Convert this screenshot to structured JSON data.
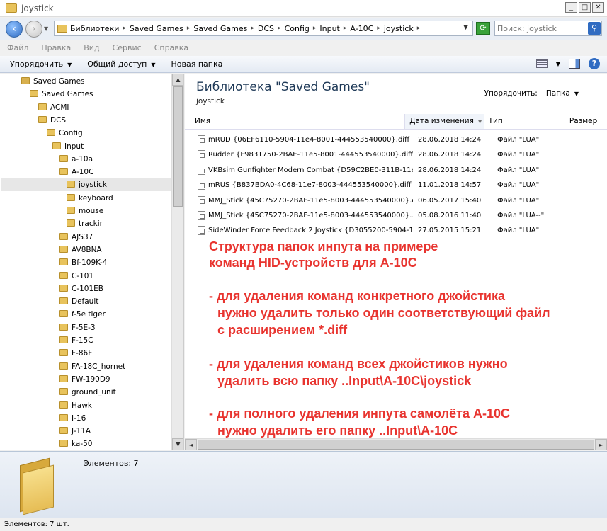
{
  "window": {
    "title": "joystick"
  },
  "address": {
    "crumbs": [
      "Библиотеки",
      "Saved Games",
      "Saved Games",
      "DCS",
      "Config",
      "Input",
      "A-10C",
      "joystick"
    ]
  },
  "search": {
    "placeholder": "Поиск: joystick"
  },
  "menu": [
    "Файл",
    "Правка",
    "Вид",
    "Сервис",
    "Справка"
  ],
  "toolbar": {
    "organize": "Упорядочить",
    "share": "Общий доступ",
    "new_folder": "Новая папка"
  },
  "tree": [
    {
      "label": "Saved Games",
      "depth": 0
    },
    {
      "label": "Saved Games",
      "depth": 1
    },
    {
      "label": "ACMI",
      "depth": 2
    },
    {
      "label": "DCS",
      "depth": 2
    },
    {
      "label": "Config",
      "depth": 3
    },
    {
      "label": "Input",
      "depth": 4
    },
    {
      "label": "a-10a",
      "depth": 5
    },
    {
      "label": "A-10C",
      "depth": 5
    },
    {
      "label": "joystick",
      "depth": 6
    },
    {
      "label": "keyboard",
      "depth": 6
    },
    {
      "label": "mouse",
      "depth": 6
    },
    {
      "label": "trackir",
      "depth": 6
    },
    {
      "label": "AJS37",
      "depth": 5
    },
    {
      "label": "AV8BNA",
      "depth": 5
    },
    {
      "label": "Bf-109K-4",
      "depth": 5
    },
    {
      "label": "C-101",
      "depth": 5
    },
    {
      "label": "C-101EB",
      "depth": 5
    },
    {
      "label": "Default",
      "depth": 5
    },
    {
      "label": "f-5e tiger",
      "depth": 5
    },
    {
      "label": "F-5E-3",
      "depth": 5
    },
    {
      "label": "F-15C",
      "depth": 5
    },
    {
      "label": "F-86F",
      "depth": 5
    },
    {
      "label": "FA-18C_hornet",
      "depth": 5
    },
    {
      "label": "FW-190D9",
      "depth": 5
    },
    {
      "label": "ground_unit",
      "depth": 5
    },
    {
      "label": "Hawk",
      "depth": 5
    },
    {
      "label": "I-16",
      "depth": 5
    },
    {
      "label": "J-11A",
      "depth": 5
    },
    {
      "label": "ka-50",
      "depth": 5
    }
  ],
  "library": {
    "title": "Библиотека \"Saved Games\"",
    "subtitle": "joystick",
    "arrange_label": "Упорядочить:",
    "arrange_value": "Папка"
  },
  "columns": {
    "name": "Имя",
    "date": "Дата изменения",
    "type": "Тип",
    "size": "Размер"
  },
  "files": [
    {
      "name": "mRUD {06EF6110-5904-11e4-8001-444553540000}.diff",
      "date": "28.06.2018 14:24",
      "type": "Файл \"LUA\""
    },
    {
      "name": "Rudder {F9831750-2BAE-11e5-8001-444553540000}.diff",
      "date": "28.06.2018 14:24",
      "type": "Файл \"LUA\""
    },
    {
      "name": "VKBsim Gunfighter Modern Combat  {D59C2BE0-311B-11e...",
      "date": "28.06.2018 14:24",
      "type": "Файл \"LUA\""
    },
    {
      "name": "mRUS {B837BDA0-4C68-11e7-8003-444553540000}.diff",
      "date": "11.01.2018 14:57",
      "type": "Файл \"LUA\""
    },
    {
      "name": "MMJ_Stick {45C75270-2BAF-11e5-8003-444553540000}.diff",
      "date": "06.05.2017 15:40",
      "type": "Файл \"LUA\""
    },
    {
      "name": "MMJ_Stick {45C75270-2BAF-11e5-8003-444553540000}....",
      "date": "05.08.2016 11:40",
      "type": "Файл \"LUA--\""
    },
    {
      "name": "SideWinder Force Feedback 2 Joystick {D3055200-5904-1...",
      "date": "27.05.2015 15:21",
      "type": "Файл \"LUA\""
    }
  ],
  "notes": [
    "Структура папок инпута на примере",
    "команд HID-устройств для А-10С",
    "- для удаления команд конкретного джойстика",
    "  нужно удалить только один соответствующий файл",
    "  с расширением *.diff",
    "- для удаления команд всех джойстиков нужно",
    "  удалить всю папку ..Input\\A-10C\\joystick",
    "- для полного удаления инпута самолёта А-10С",
    "  нужно удалить его папку ..Input\\A-10C"
  ],
  "details": {
    "count": "Элементов: 7"
  },
  "status": "Элементов: 7 шт.",
  "colors": {
    "note_red": "#e8342f",
    "selection": "#e7e7e7"
  }
}
